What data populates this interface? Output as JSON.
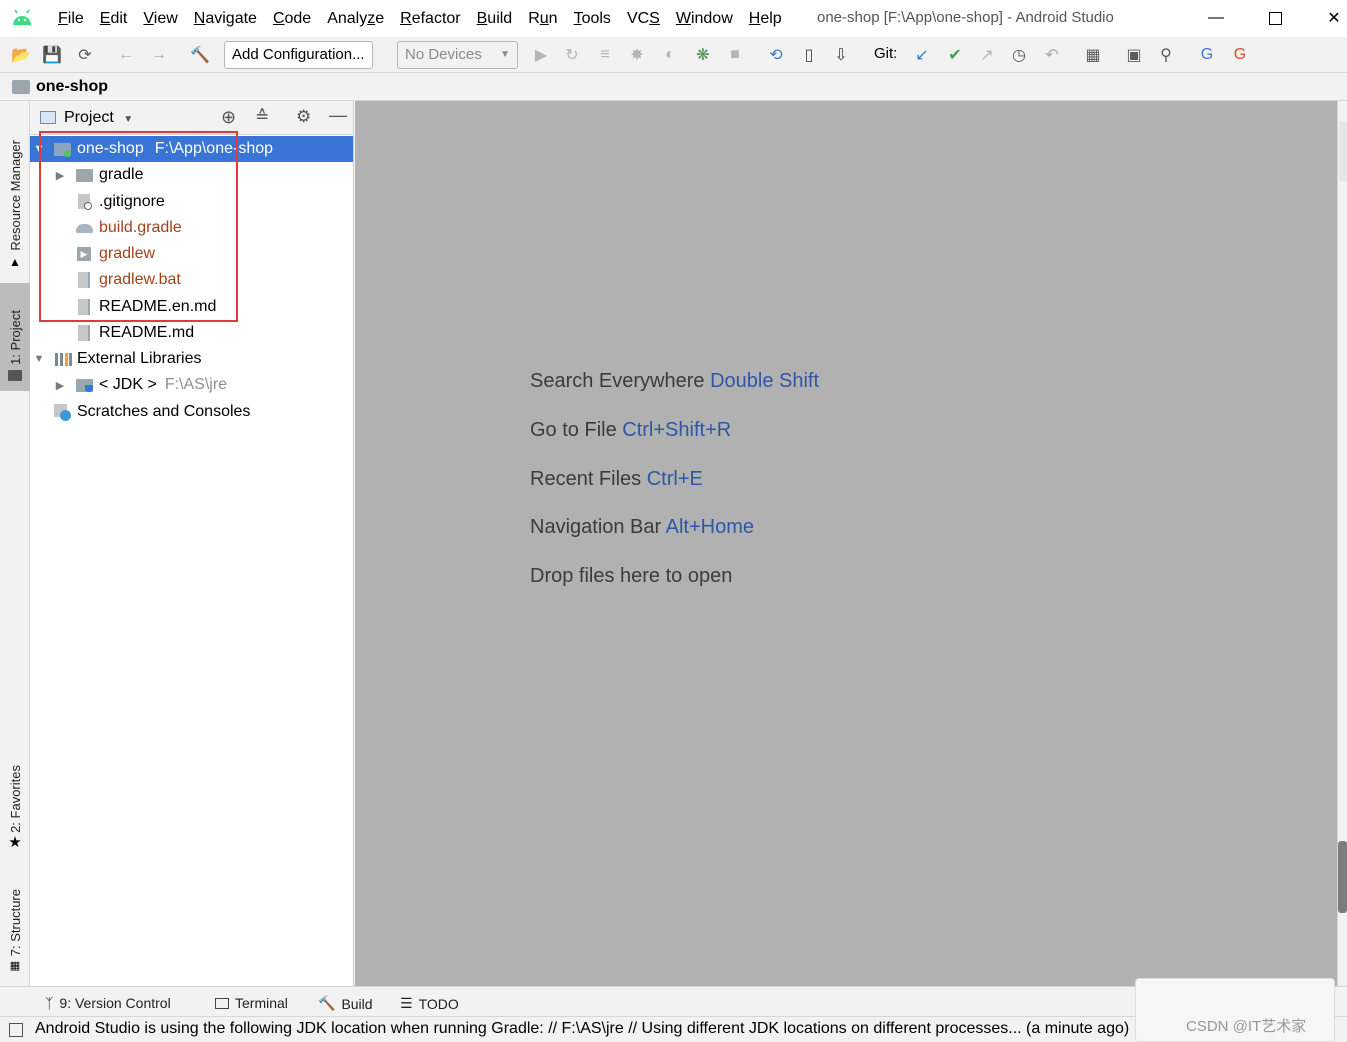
{
  "window": {
    "title": "one-shop [F:\\App\\one-shop] - Android Studio"
  },
  "menu": [
    "File",
    "Edit",
    "View",
    "Navigate",
    "Code",
    "Analyze",
    "Refactor",
    "Build",
    "Run",
    "Tools",
    "VCS",
    "Window",
    "Help"
  ],
  "menu_mnemonics": [
    "F",
    "E",
    "V",
    "N",
    "C",
    "z",
    "R",
    "B",
    "u",
    "T",
    "S",
    "W",
    "H"
  ],
  "toolbar": {
    "add_config": "Add Configuration...",
    "devices": "No Devices",
    "git_label": "Git:"
  },
  "breadcrumb": {
    "project": "one-shop"
  },
  "left_tabs": {
    "resource_manager": "Resource Manager",
    "project": "1: Project",
    "favorites": "2: Favorites",
    "structure": "7: Structure"
  },
  "project_panel": {
    "view_selector": "Project",
    "tree": [
      {
        "label": "one-shop",
        "suffix": "F:\\App\\one-shop",
        "level": 0,
        "expanded": true,
        "selected": true,
        "icon": "module-folder-icon"
      },
      {
        "label": "gradle",
        "level": 1,
        "expanded": false,
        "icon": "folder-icon"
      },
      {
        "label": ".gitignore",
        "level": 1,
        "icon": "gitignore-file-icon"
      },
      {
        "label": "build.gradle",
        "level": 1,
        "icon": "gradle-file-icon",
        "modified": true
      },
      {
        "label": "gradlew",
        "level": 1,
        "icon": "shell-file-icon",
        "modified": true
      },
      {
        "label": "gradlew.bat",
        "level": 1,
        "icon": "text-file-icon",
        "modified": true
      },
      {
        "label": "README.en.md",
        "level": 1,
        "icon": "text-file-icon"
      },
      {
        "label": "README.md",
        "level": 1,
        "icon": "text-file-icon"
      },
      {
        "label": "External Libraries",
        "level": 0,
        "expanded": true,
        "icon": "library-icon"
      },
      {
        "label": "< JDK >",
        "suffix": "F:\\AS\\jre",
        "level": 1,
        "expanded": false,
        "icon": "jdk-folder-icon"
      },
      {
        "label": "Scratches and Consoles",
        "level": 0,
        "icon": "scratches-icon"
      }
    ]
  },
  "editor_hints": [
    {
      "text": "Search Everywhere",
      "key": "Double Shift"
    },
    {
      "text": "Go to File",
      "key": "Ctrl+Shift+R"
    },
    {
      "text": "Recent Files",
      "key": "Ctrl+E"
    },
    {
      "text": "Navigation Bar",
      "key": "Alt+Home"
    },
    {
      "text": "Drop files here to open",
      "key": ""
    }
  ],
  "bottom_tabs": {
    "version_control": "9: Version Control",
    "terminal": "Terminal",
    "build": "Build",
    "todo": "TODO"
  },
  "status": {
    "message": "Android Studio is using the following JDK location when running Gradle: // F:\\AS\\jre // Using different JDK locations on different processes... (a minute ago)"
  },
  "watermark": {
    "text": "CSDN @IT艺术家"
  },
  "colors": {
    "selection": "#3875d7",
    "modified_file": "#a3421a",
    "editor_bg": "#b1b1b1",
    "shortcut": "#2e57a8",
    "android_green": "#3ddc84",
    "highlight_box": "#e03a3a"
  }
}
